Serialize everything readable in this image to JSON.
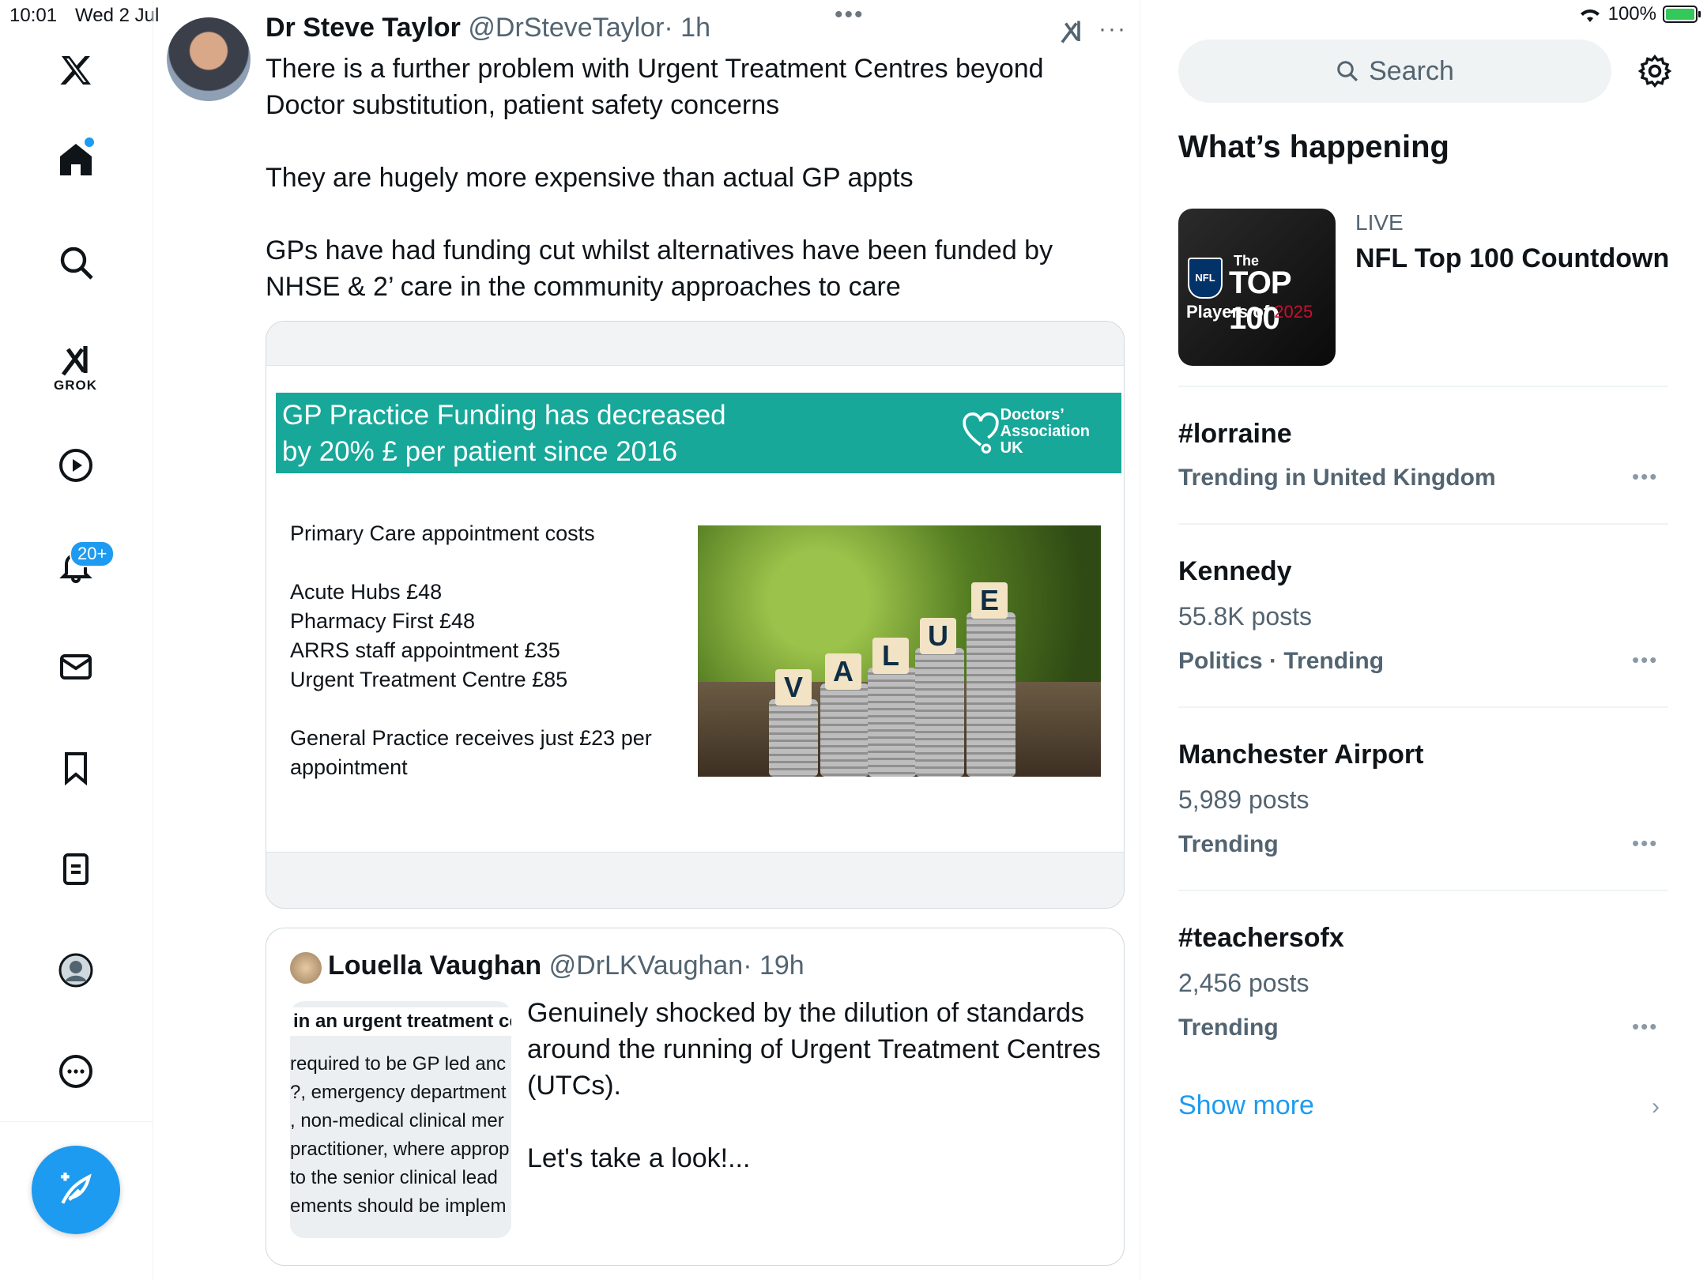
{
  "status_bar": {
    "time": "10:01",
    "date": "Wed 2 Jul",
    "battery": "100%"
  },
  "nav": {
    "items": [
      "x-logo",
      "home",
      "explore",
      "grok",
      "video",
      "notifications",
      "messages",
      "bookmarks",
      "lists",
      "profile",
      "more"
    ],
    "grok_label": "GROK",
    "notification_badge": "20+"
  },
  "tweet": {
    "author_name": "Dr Steve Taylor",
    "author_handle": "@DrSteveTaylor",
    "time": "· 1h",
    "paragraphs": [
      "There is a further problem with Urgent Treatment Centres beyond Doctor substitution, patient safety concerns",
      "They are hugely more expensive than actual GP appts",
      "GPs have had funding cut whilst alternatives have been funded by NHSE & 2’ care in the community approaches to care"
    ],
    "media": {
      "banner_line1": "GP Practice Funding has decreased",
      "banner_line2": "by 20% £ per patient since 2016",
      "logo_line1": "Doctors’",
      "logo_line2": "Association",
      "logo_line3": "UK",
      "list_title": "Primary Care appointment costs",
      "list_items": [
        "Acute Hubs £48",
        "Pharmacy First £48",
        "ARRS staff appointment £35",
        "Urgent Treatment Centre £85"
      ],
      "footer_line1": "General Practice receives just £23 per",
      "footer_line2": "appointment",
      "cube_letters": [
        "V",
        "A",
        "L",
        "U",
        "E"
      ]
    }
  },
  "quote": {
    "author_name": "Louella Vaughan",
    "author_handle": "@DrLKVaughan",
    "time": "· 19h",
    "image_lines": [
      "in an urgent treatment ce",
      "required to be GP led anc",
      "?, emergency department",
      ", non-medical clinical mer",
      "practitioner, where approp",
      " to the senior clinical lead",
      "ements should be implem"
    ],
    "paragraphs": [
      "Genuinely shocked by the dilution of standards around the running of Urgent Treatment Centres (UTCs).",
      "Let's take a look!..."
    ]
  },
  "sidebar": {
    "search_placeholder": "Search",
    "section_title": "What’s happening",
    "live": {
      "label": "LIVE",
      "title": "NFL Top 100 Countdown",
      "img_the": "The",
      "img_top": "TOP 100",
      "img_players": "Players of ",
      "img_year": "2025",
      "img_nfl": "NFL"
    },
    "trends": [
      {
        "title": "#lorraine",
        "line": "",
        "meta": "Trending in United Kingdom"
      },
      {
        "title": "Kennedy",
        "line": "55.8K posts",
        "meta": "Politics · Trending"
      },
      {
        "title": "Manchester Airport",
        "line": "5,989 posts",
        "meta": "Trending"
      },
      {
        "title": "#teachersofx",
        "line": "2,456 posts",
        "meta": "Trending"
      }
    ],
    "show_more": "Show more"
  },
  "colors": {
    "accent": "#1d9bf0",
    "banner": "#17a89a",
    "muted": "#536471"
  }
}
